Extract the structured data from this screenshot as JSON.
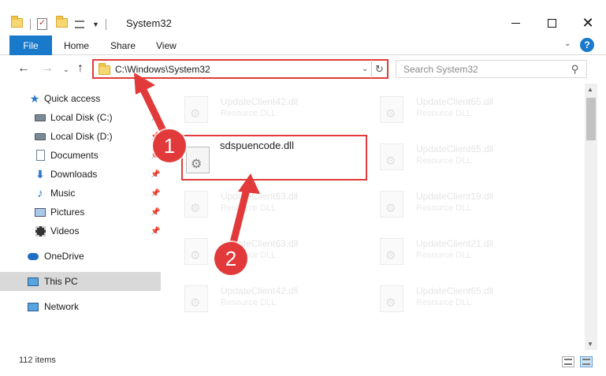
{
  "window": {
    "title": "System32",
    "minimize_glyph": "",
    "close_glyph": "✕"
  },
  "ribbon": {
    "file_tab": "File",
    "tabs": [
      "Home",
      "Share",
      "View"
    ],
    "help_glyph": "?",
    "expand_glyph": "⌄"
  },
  "nav": {
    "back_glyph": "←",
    "forward_glyph": "→",
    "recent_glyph": "⌄",
    "up_glyph": "↑",
    "address": "C:\\Windows\\System32",
    "address_drop_glyph": "⌄",
    "refresh_glyph": "↻",
    "search_placeholder": "Search System32",
    "search_glyph": "⚲"
  },
  "sidebar": {
    "items": [
      {
        "label": "Quick access",
        "pinned": false
      },
      {
        "label": "Local Disk (C:)",
        "pinned": true
      },
      {
        "label": "Local Disk (D:)",
        "pinned": true
      },
      {
        "label": "Documents",
        "pinned": true
      },
      {
        "label": "Downloads",
        "pinned": true
      },
      {
        "label": "Music",
        "pinned": true
      },
      {
        "label": "Pictures",
        "pinned": true
      },
      {
        "label": "Videos",
        "pinned": true
      },
      {
        "label": "OneDrive",
        "pinned": false
      },
      {
        "label": "This PC",
        "pinned": false,
        "selected": true
      },
      {
        "label": "Network",
        "pinned": false
      }
    ],
    "pin_glyph": "📌",
    "star_glyph": "★",
    "download_glyph": "⬇",
    "music_glyph": "♪"
  },
  "files": {
    "left": [
      {
        "name": "UpdateClient42.dll",
        "type": "Resource DLL"
      },
      {
        "name": "UpdateClient63.dll",
        "type": "Resource DLL"
      },
      {
        "name": "UpdateClient63.dll",
        "type": "Resource DLL"
      },
      {
        "name": "UpdateClient42.dll",
        "type": "Resource DLL"
      }
    ],
    "right": [
      {
        "name": "UpdateClient65.dll",
        "type": "Resource DLL"
      },
      {
        "name": "UpdateClient65.dll",
        "type": "Resource DLL"
      },
      {
        "name": "UpdateClient19.dll",
        "type": "Resource DLL"
      },
      {
        "name": "UpdateClient21.dll",
        "type": "Resource DLL"
      },
      {
        "name": "UpdateClient65.dll",
        "type": "Resource DLL"
      }
    ],
    "highlighted": {
      "name": "sdspuencode.dll"
    },
    "gear_glyph": "⚙"
  },
  "scrollbar": {
    "up_glyph": "▲",
    "down_glyph": "▼"
  },
  "status": {
    "item_count": "112 items"
  },
  "annotations": {
    "step1": "1",
    "step2": "2",
    "color": "#e23a3a"
  }
}
